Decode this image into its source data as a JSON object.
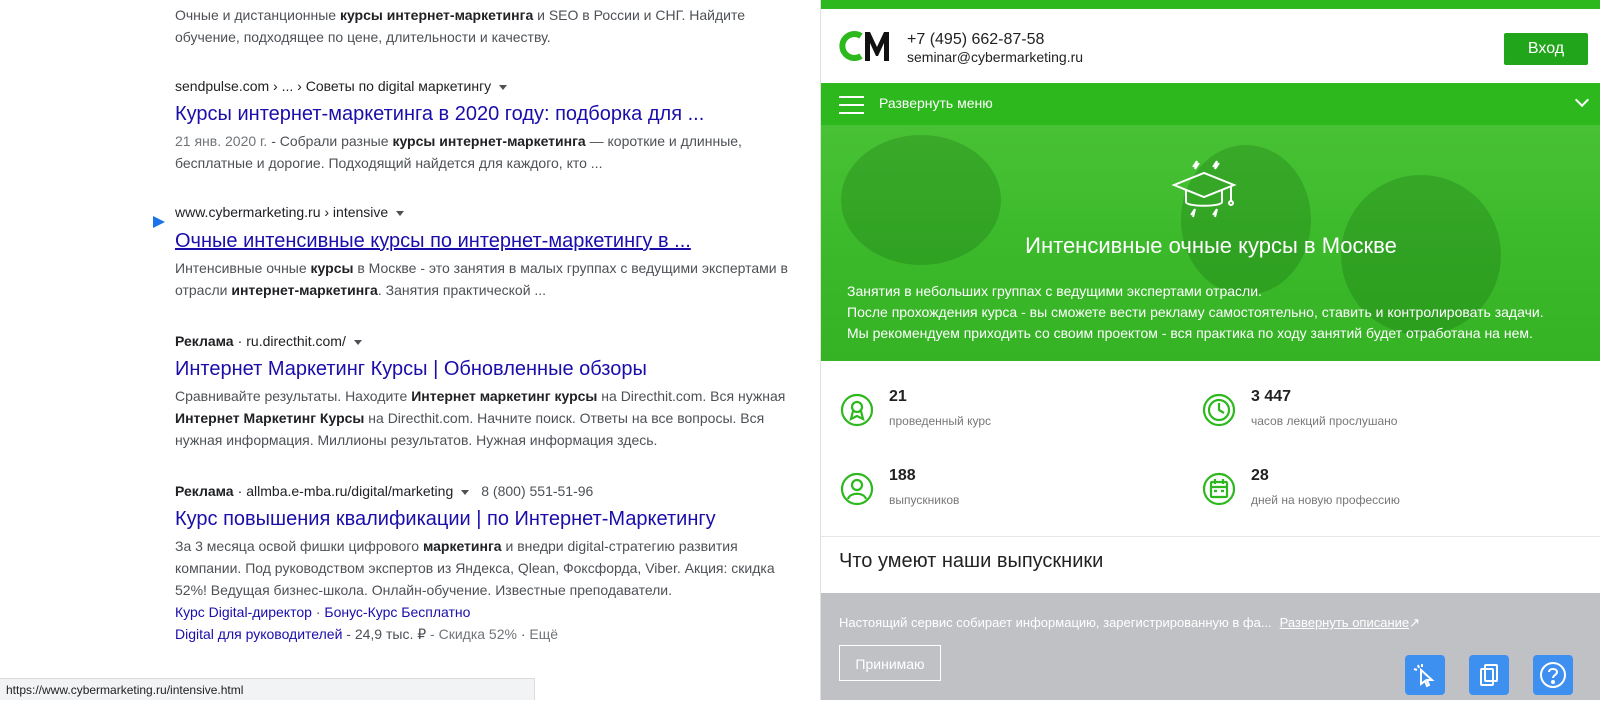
{
  "serp": {
    "r0": {
      "snippet_pre": "Очные и дистанционные ",
      "snippet_b1": "курсы интернет-маркетинга",
      "snippet_mid": " и SEO в России и СНГ. Найдите обучение, подходящее по цене, длительности и качеству."
    },
    "r1": {
      "cite": "sendpulse.com › ... › Советы по digital маркетингу",
      "title": "Курсы интернет-маркетинга в 2020 году: подборка для ...",
      "date": "21 янв. 2020 г.",
      "snippet_a": " - Собрали разные ",
      "snippet_b": "курсы интернет-маркетинга",
      "snippet_c": " — короткие и длинные, бесплатные и дорогие. Подходящий найдется для каждого, кто ..."
    },
    "r2": {
      "cite": "www.cybermarketing.ru › intensive",
      "title": "Очные интенсивные курсы по интернет-маркетингу в ...",
      "snippet_a": "Интенсивные очные ",
      "snippet_b": "курсы",
      "snippet_c": " в Москве",
      "snippet_d": " - это занятия в малых группах с ведущими экспертами в отрасли ",
      "snippet_e": "интернет-маркетинга",
      "snippet_f": ". Занятия практической ..."
    },
    "r3": {
      "ad": "Реклама",
      "cite": "ru.directhit.com/",
      "title": "Интернет Маркетинг Курсы | Обновленные обзоры",
      "snippet_a": "Сравнивайте результаты. Находите ",
      "snippet_b": "Интернет маркетинг курсы",
      "snippet_c": " на Directhit.com. Вся нужная ",
      "snippet_d": "Интернет Маркетинг Курсы",
      "snippet_e": " на Directhit.com. Начните поиск. Ответы на все вопросы. Вся нужная информация. Миллионы результатов. Нужная информация здесь."
    },
    "r4": {
      "ad": "Реклама",
      "cite": "allmba.e-mba.ru/digital/marketing",
      "phone": "8 (800) 551-51-96",
      "title": "Курс повышения квалификации | по Интернет-Маркетингу",
      "snippet_a": "За 3 месяца освой фишки цифрового ",
      "snippet_b": "маркетинга",
      "snippet_c": " и внедри digital-стратегию развития компании. Под руководством экспертов из Яндекса, Qlean, Фоксфорда, Viber. Акция: скидка 52%! Ведущая бизнес-школа. Онлайн-обучение. Известные преподаватели.",
      "sl1": "Курс Digital-директор",
      "sl2": "Бонус-Курс Бесплатно",
      "sl3": "Digital для руководителей",
      "sl3_price": " - 24,9 тыс. ₽",
      "sl3_disc": " - Скидка 52%",
      "more": "Ещё"
    },
    "status_url": "https://www.cybermarketing.ru/intensive.html"
  },
  "site": {
    "phone": "+7 (495) 662-87-58",
    "email": "seminar@cybermarketing.ru",
    "login": "Вход",
    "menu_label": "Развернуть меню",
    "hero_title": "Интенсивные очные курсы в Москве",
    "hero_lines": [
      "Занятия в небольших группах с ведущими экспертами отрасли.",
      "После прохождения курса - вы сможете вести рекламу самостоятельно, ставить и контролировать задачи.",
      "Мы рекомендуем приходить со своим проектом - вся практика по ходу занятий будет отработана на нем."
    ],
    "stats": [
      {
        "num": "21",
        "label": "проведенный курс",
        "icon": "award-icon"
      },
      {
        "num": "3 447",
        "label": "часов лекций прослушано",
        "icon": "clock-icon"
      },
      {
        "num": "188",
        "label": "выпускников",
        "icon": "user-icon"
      },
      {
        "num": "28",
        "label": "дней на новую профессию",
        "icon": "calendar-icon"
      }
    ],
    "section_title": "Что умеют наши выпускники",
    "cookie_text": "Настоящий сервис собирает информацию, зарегистрированную в фа...",
    "cookie_link": "Развернуть описание",
    "accept": "Принимаю"
  },
  "colors": {
    "green": "#2db81e",
    "link": "#1a0dab",
    "fab": "#3d8ff0"
  }
}
